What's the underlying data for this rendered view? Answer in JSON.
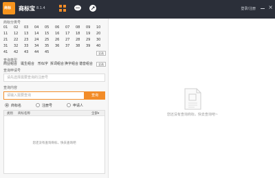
{
  "titlebar": {
    "logo_text": "商标",
    "app_name": "商标宝",
    "version": "8.1.4",
    "login": "登录/注册",
    "close": "×",
    "nav_icons": [
      "grid-icon",
      "chat-icon",
      "share-icon"
    ]
  },
  "classes": {
    "title": "商标分类号",
    "items": [
      "01",
      "02",
      "03",
      "04",
      "05",
      "06",
      "07",
      "08",
      "09",
      "10",
      "11",
      "12",
      "13",
      "14",
      "15",
      "16",
      "17",
      "18",
      "19",
      "20",
      "21",
      "22",
      "23",
      "24",
      "25",
      "26",
      "27",
      "28",
      "29",
      "30",
      "31",
      "32",
      "33",
      "34",
      "35",
      "36",
      "37",
      "38",
      "39",
      "40",
      "41",
      "42",
      "43",
      "44",
      "45"
    ],
    "select_all": "全选"
  },
  "patent_types": {
    "title": "查询类型",
    "items": [
      "商业组合",
      "诞生组合",
      "形似字",
      "拆词组合",
      "换字组合",
      "谐音组合"
    ],
    "select_all": "全选"
  },
  "applicant": {
    "title": "查询申请号",
    "placeholder": "请先选择需要查询的注册号"
  },
  "search": {
    "title": "查询内容",
    "placeholder": "请输入需要查询",
    "button": "查询"
  },
  "radios": [
    {
      "label": "商标名",
      "selected": true
    },
    {
      "label": "注册号",
      "selected": false
    },
    {
      "label": "申请人",
      "selected": false
    }
  ],
  "results": {
    "col_class": "类别",
    "col_name": "商标名称",
    "col_all": "全部▾",
    "empty": "您还没有查询商标，快去查询吧"
  },
  "main": {
    "empty_text": "您还没有查询商标，快去查询吧~"
  },
  "colors": {
    "titlebar": "#2b2f39",
    "accent": "#f28c28",
    "logo": "#f7941d"
  }
}
